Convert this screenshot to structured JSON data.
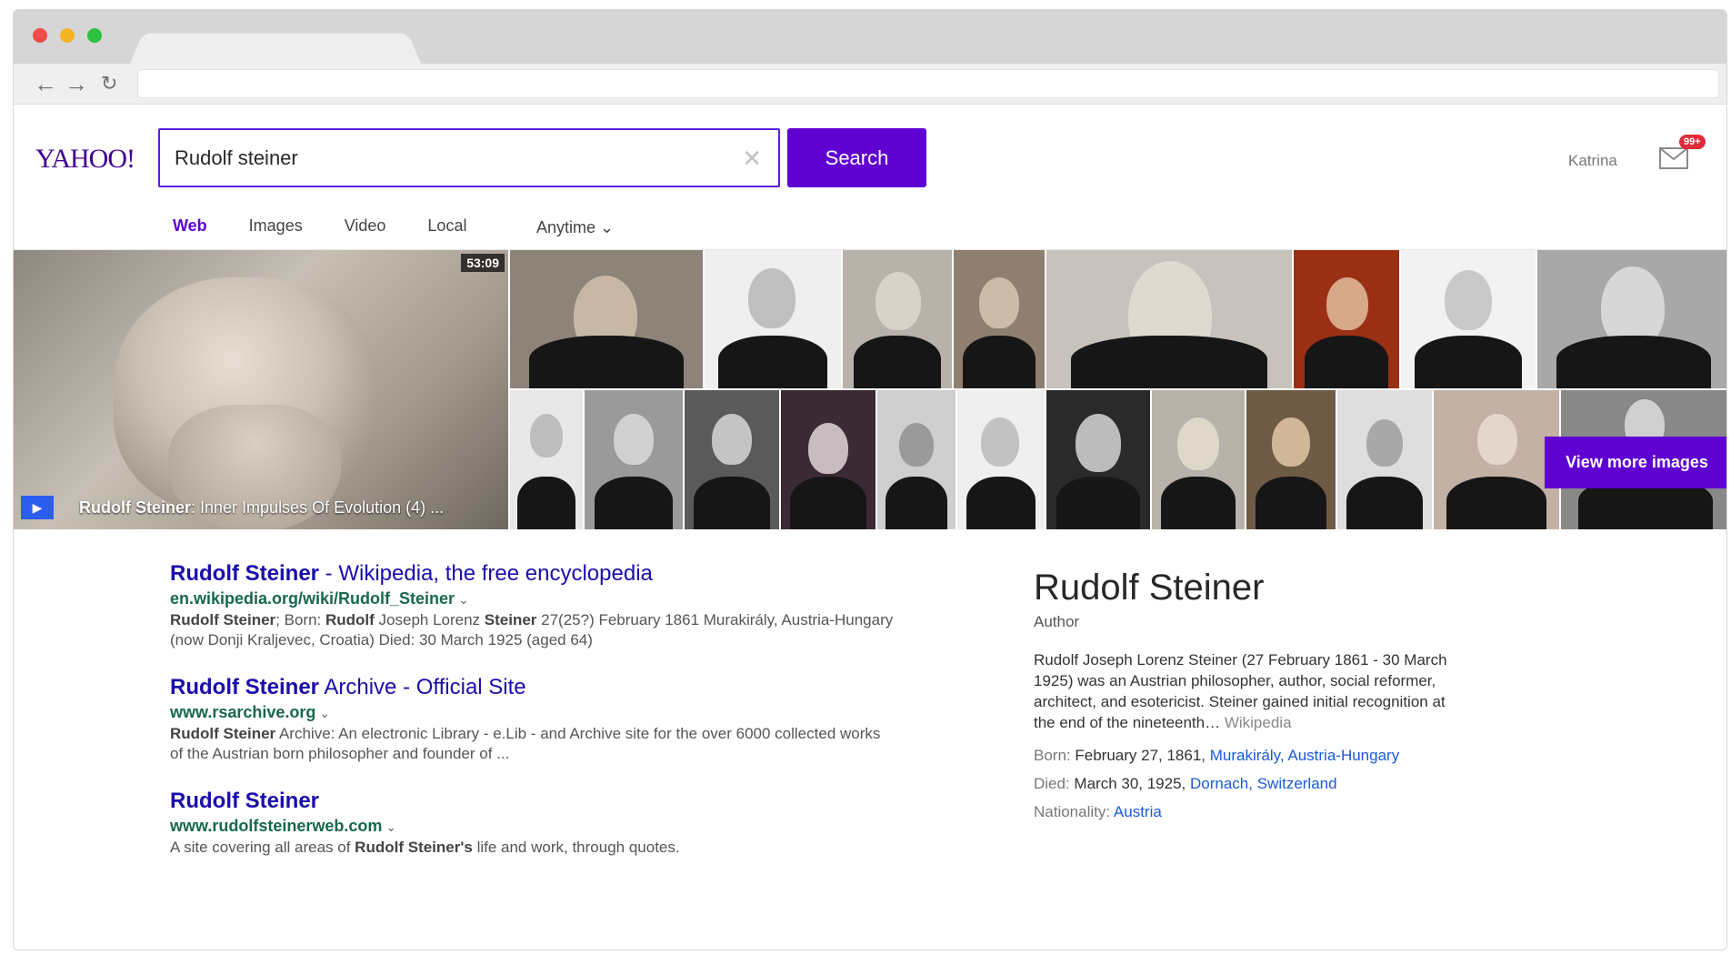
{
  "browser": {
    "nav": {
      "back": "←",
      "forward": "→",
      "reload": "↻"
    },
    "url": ""
  },
  "header": {
    "logo": "YAHOO!",
    "search_query": "Rudolf steiner",
    "clear_glyph": "✕",
    "search_button": "Search",
    "username": "Katrina",
    "mail_badge": "99+"
  },
  "vertical_tabs": [
    {
      "label": "Web",
      "active": true
    },
    {
      "label": "Images",
      "active": false
    },
    {
      "label": "Video",
      "active": false
    },
    {
      "label": "Local",
      "active": false
    }
  ],
  "time_filter": "Anytime ⌄",
  "image_strip": {
    "video": {
      "duration": "53:09",
      "title_bold": "Rudolf Steiner",
      "title_rest": ": Inner Impulses Of Evolution (4) ...",
      "play_glyph": "▶"
    },
    "more_button": "View more images"
  },
  "results": [
    {
      "title_bold": "Rudolf Steiner",
      "title_rest": " - Wikipedia, the free encyclopedia",
      "url": "en.wikipedia.org/wiki/Rudolf_Steiner",
      "caret": "⌄",
      "snippet_parts": [
        {
          "t": "Rudolf Steiner",
          "b": true
        },
        {
          "t": "; Born: ",
          "b": false
        },
        {
          "t": "Rudolf",
          "b": true
        },
        {
          "t": " Joseph Lorenz ",
          "b": false
        },
        {
          "t": "Steiner",
          "b": true
        },
        {
          "t": " 27(25?) February 1861 Murakirály, Austria-Hungary (now Donji Kraljevec, Croatia) Died: 30 March 1925 (aged 64)",
          "b": false
        }
      ]
    },
    {
      "title_bold": "Rudolf Steiner",
      "title_rest": " Archive - Official Site",
      "url": "www.rsarchive.org",
      "caret": "⌄",
      "snippet_parts": [
        {
          "t": "Rudolf Steiner",
          "b": true
        },
        {
          "t": " Archive: An electronic Library - e.Lib - and Archive site for the over 6000 collected works of the Austrian born philosopher and founder of ...",
          "b": false
        }
      ]
    },
    {
      "title_bold": "Rudolf Steiner",
      "title_rest": "",
      "url": "www.rudolfsteinerweb.com",
      "caret": "⌄",
      "snippet_parts": [
        {
          "t": "A site covering all areas of ",
          "b": false
        },
        {
          "t": "Rudolf Steiner's",
          "b": true
        },
        {
          "t": " life and work, through quotes.",
          "b": false
        }
      ]
    }
  ],
  "knowledge_panel": {
    "title": "Rudolf Steiner",
    "subtitle": "Author",
    "description": "Rudolf Joseph Lorenz Steiner (27 February 1861 - 30 March 1925) was an Austrian philosopher, author, social reformer, architect, and esotericist. Steiner gained initial recognition at the end of the nineteenth…",
    "source": " Wikipedia",
    "facts": [
      {
        "label": "Born:",
        "value": " February 27, 1861, ",
        "link": "Murakirály, Austria-Hungary"
      },
      {
        "label": "Died:",
        "value": " March 30, 1925, ",
        "link": "Dornach, Switzerland"
      },
      {
        "label": "Nationality:",
        "value": " ",
        "link": "Austria"
      }
    ]
  }
}
